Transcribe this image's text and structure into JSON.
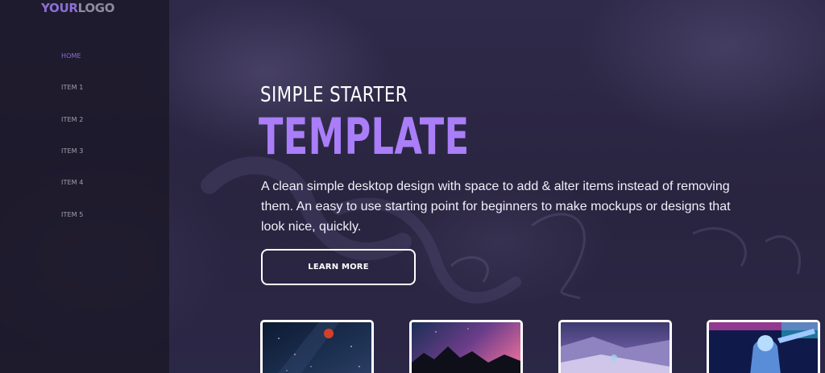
{
  "logo": {
    "part1": "YOUR",
    "part2": "LOGO"
  },
  "nav": {
    "items": [
      {
        "label": "HOME",
        "active": true
      },
      {
        "label": "ITEM 1"
      },
      {
        "label": "ITEM 2"
      },
      {
        "label": "ITEM 3"
      },
      {
        "label": "ITEM 4"
      },
      {
        "label": "ITEM 5"
      }
    ]
  },
  "hero": {
    "title_small": "SIMPLE STARTER",
    "title_big": "TEMPLATE",
    "body": "A clean simple desktop design with space to add & alter items instead of removing them. An easy to use starting point for beginners to make mockups or designs that look nice, quickly.",
    "cta_label": "LEARN MORE"
  },
  "colors": {
    "accent": "#a97ef8",
    "logo_accent": "#8c6fd6",
    "background": "#2b2744",
    "sidebar": "#1c1928"
  },
  "cards": [
    {
      "icon": "night-sky-moon-image"
    },
    {
      "icon": "mountain-sunset-image"
    },
    {
      "icon": "snowy-landscape-image"
    },
    {
      "icon": "cyberpunk-figure-image"
    }
  ]
}
